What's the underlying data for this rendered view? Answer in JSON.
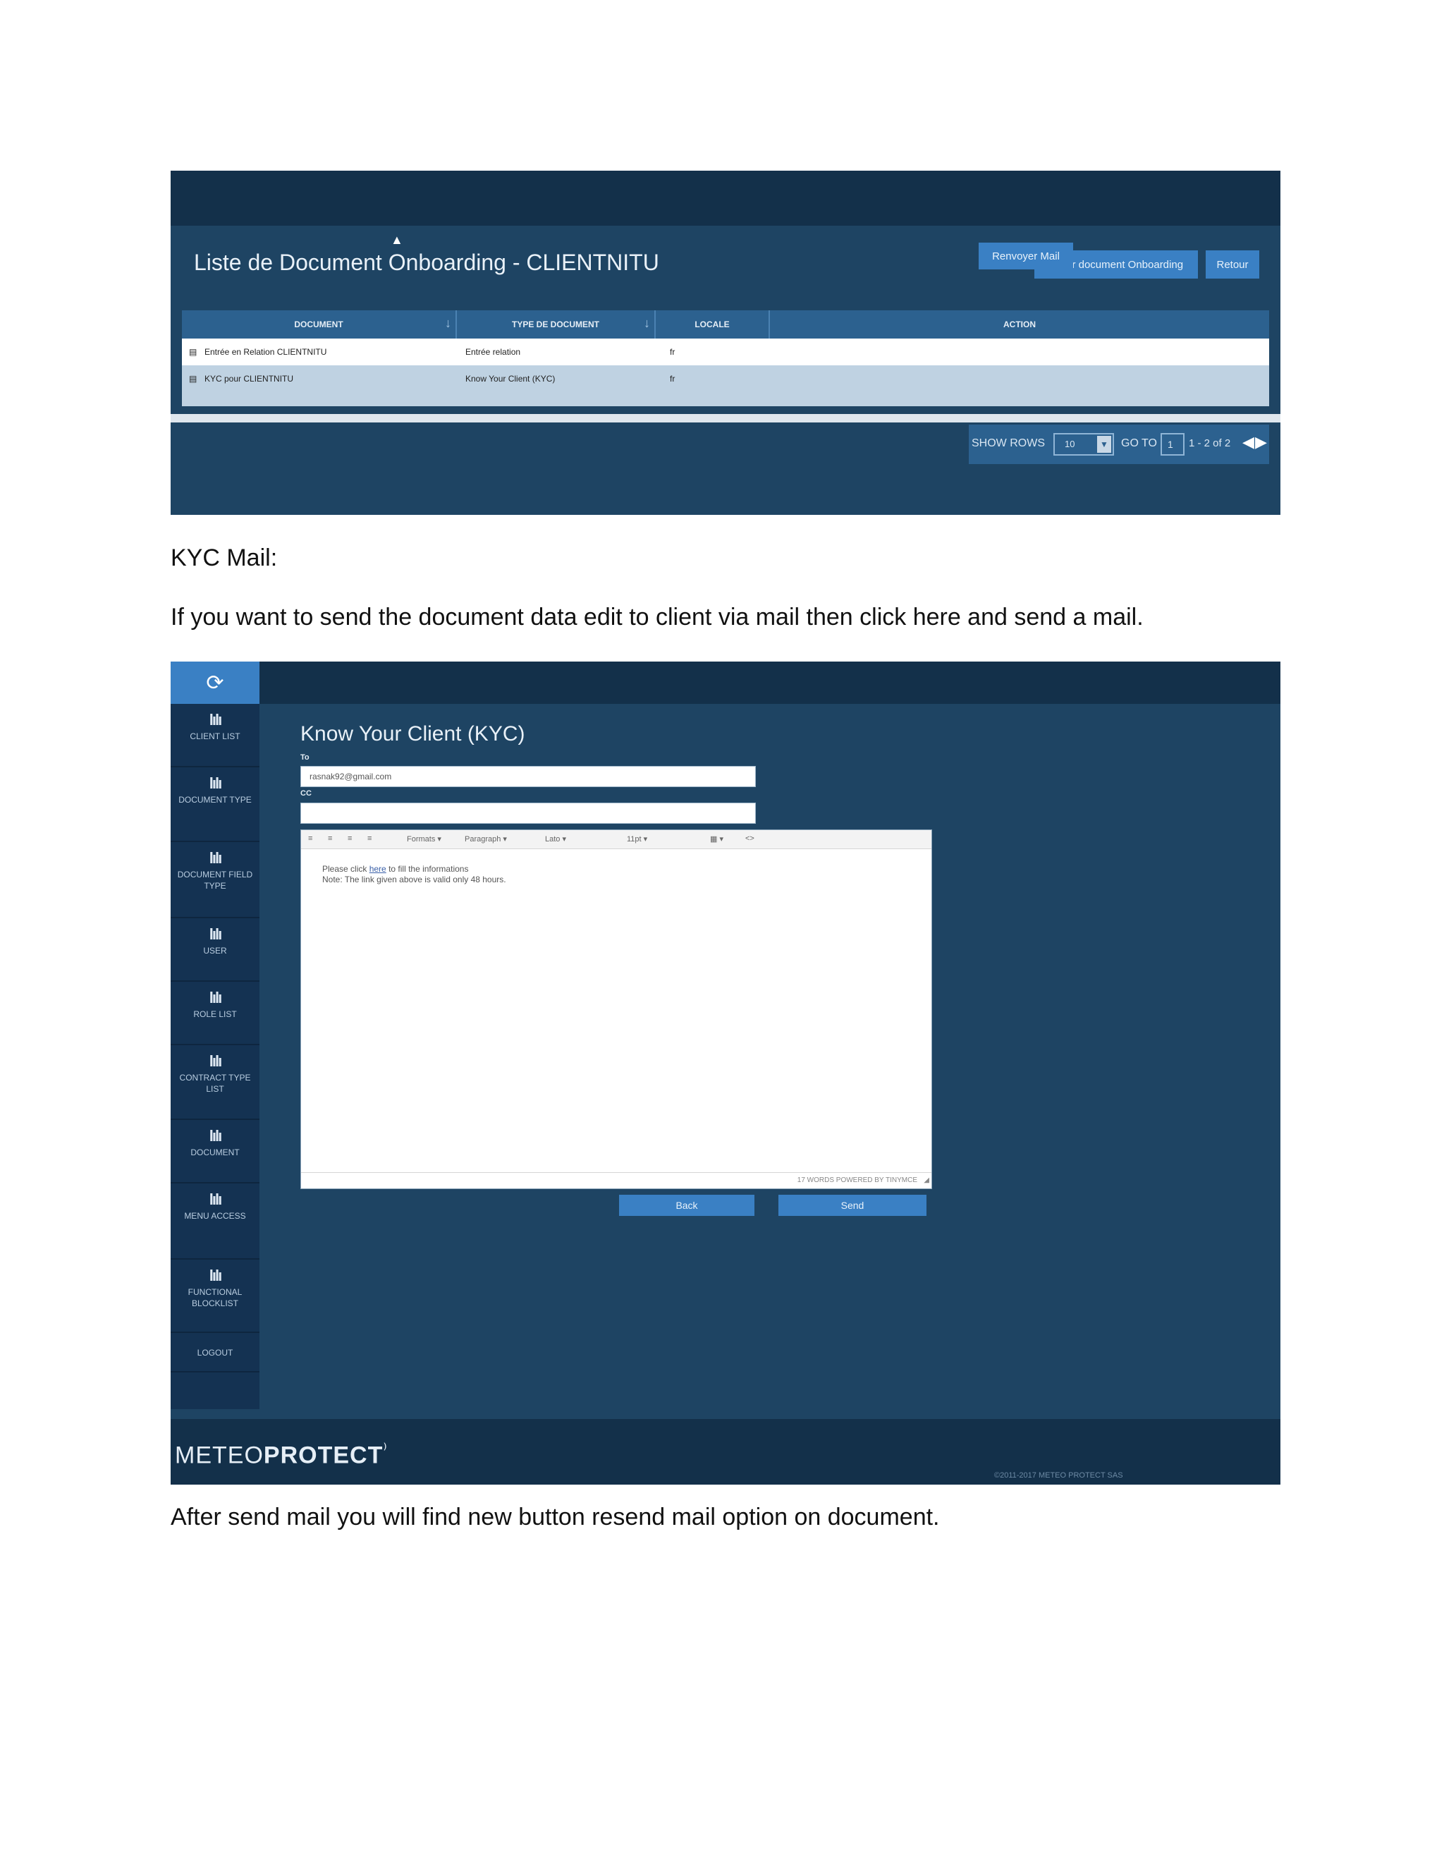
{
  "screenshot1": {
    "title": "Liste de Document Onboarding - CLIENTNITU",
    "btn_create": "Créer document Onboarding",
    "btn_retour": "Retour",
    "columns": [
      "DOCUMENT",
      "TYPE DE DOCUMENT",
      "LOCALE",
      "ACTION"
    ],
    "rows": [
      {
        "document": "Entrée en Relation CLIENTNITU",
        "type": "Entrée relation",
        "locale": "fr",
        "action": ""
      },
      {
        "document": "KYC pour CLIENTNITU",
        "type": "Know Your Client (KYC)",
        "locale": "fr",
        "action": "Renvoyer Mail"
      }
    ],
    "pager": {
      "show_rows_label": "SHOW ROWS",
      "rows_value": "10",
      "goto_label": "GO TO",
      "goto_value": "1",
      "range": "1 - 2 of 2"
    }
  },
  "doc": {
    "heading": "KYC Mail:",
    "para1": "If you want to send the document data edit to client via mail then click here and send a mail.",
    "para2": "After send mail you will find new button resend mail option on document."
  },
  "screenshot2": {
    "nav": [
      "CLIENT LIST",
      "DOCUMENT TYPE",
      "DOCUMENT FIELD TYPE",
      "USER",
      "ROLE LIST",
      "CONTRACT TYPE LIST",
      "DOCUMENT",
      "MENU ACCESS",
      "FUNCTIONAL BLOCKLIST",
      "LOGOUT"
    ],
    "title": "Know Your Client (KYC)",
    "to_label": "To",
    "to_value": "rasnak92@gmail.com",
    "cc_label": "CC",
    "cc_value": "",
    "toolbar": {
      "formats": "Formats",
      "paragraph": "Paragraph",
      "font": "Lato",
      "size": "11pt"
    },
    "body_line1_pre": "Please click ",
    "body_link": "here",
    "body_line1_post": " to fill the informations",
    "body_line2": "Note: The link given above is valid only 48 hours.",
    "status": "17 WORDS POWERED BY TINYMCE",
    "btn_back": "Back",
    "btn_send": "Send",
    "brand_light": "METEO",
    "brand_bold": "PROTECT",
    "copyright": "©2011-2017 METEO PROTECT SAS"
  }
}
